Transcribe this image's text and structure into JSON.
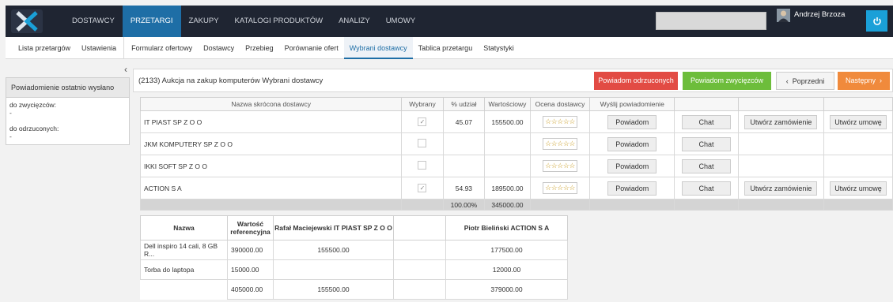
{
  "topnav": {
    "items": [
      "DOSTAWCY",
      "PRZETARGI",
      "ZAKUPY",
      "KATALOGI PRODUKTÓW",
      "ANALIZY",
      "UMOWY"
    ],
    "active_index": 1,
    "user_name": "Andrzej Brzoza"
  },
  "subnav": {
    "items": [
      "Lista przetargów",
      "Ustawienia",
      "Formularz ofertowy",
      "Dostawcy",
      "Przebieg",
      "Porównanie ofert",
      "Wybrani dostawcy",
      "Tablica przetargu",
      "Statystyki"
    ],
    "active_index": 6
  },
  "sidebar": {
    "collapse_glyph": "‹",
    "header": "Powiadomienie ostatnio wysłano",
    "winners_label": "do zwycięzców:",
    "winners_value": "-",
    "rejected_label": "do odrzuconych:",
    "rejected_value": "-"
  },
  "main": {
    "title": "(2133) Aukcja na zakup komputerów Wybrani dostawcy",
    "btn_notify_rejected": "Powiadom odrzuconych",
    "btn_notify_winners": "Powiadom zwycięzców",
    "btn_prev": "Poprzedni",
    "btn_next": "Następny",
    "columns": {
      "name": "Nazwa skrócona dostawcy",
      "selected": "Wybrany",
      "share": "% udział",
      "value": "Wartościowy",
      "rating": "Ocena dostawcy",
      "send": "Wyślij powiadomienie"
    },
    "rows": [
      {
        "name": "IT PIAST SP Z O O",
        "selected": true,
        "share": "45.07",
        "value": "155500.00",
        "notify": "Powiadom",
        "chat": "Chat",
        "order": "Utwórz zamówienie",
        "contract": "Utwórz umowę"
      },
      {
        "name": "JKM KOMPUTERY SP Z O O",
        "selected": false,
        "share": "",
        "value": "",
        "notify": "Powiadom",
        "chat": "Chat",
        "order": "",
        "contract": ""
      },
      {
        "name": "IKKI SOFT SP Z O O",
        "selected": false,
        "share": "",
        "value": "",
        "notify": "Powiadom",
        "chat": "Chat",
        "order": "",
        "contract": ""
      },
      {
        "name": "ACTION S A",
        "selected": true,
        "share": "54.93",
        "value": "189500.00",
        "notify": "Powiadom",
        "chat": "Chat",
        "order": "Utwórz zamówienie",
        "contract": "Utwórz umowę"
      }
    ],
    "rating_stars": "☆☆☆☆☆",
    "totals": {
      "share": "100.00%",
      "value": "345000.00"
    }
  },
  "items_table": {
    "col_name": "Nazwa",
    "col_ref": "Wartość referencyjna",
    "col_supplier1": "Rafał Maciejewski IT PIAST SP Z O O",
    "col_supplier2": "Piotr Bieliński ACTION S A",
    "rows": [
      {
        "name": "Dell inspiro 14 cali, 8 GB R...",
        "ref": "390000.00",
        "s1": "155500.00",
        "s2": "177500.00"
      },
      {
        "name": "Torba do laptopa",
        "ref": "15000.00",
        "s1": "",
        "s2": "12000.00"
      }
    ],
    "total": {
      "ref": "405000.00",
      "s1": "155500.00",
      "s2": "379000.00"
    }
  }
}
